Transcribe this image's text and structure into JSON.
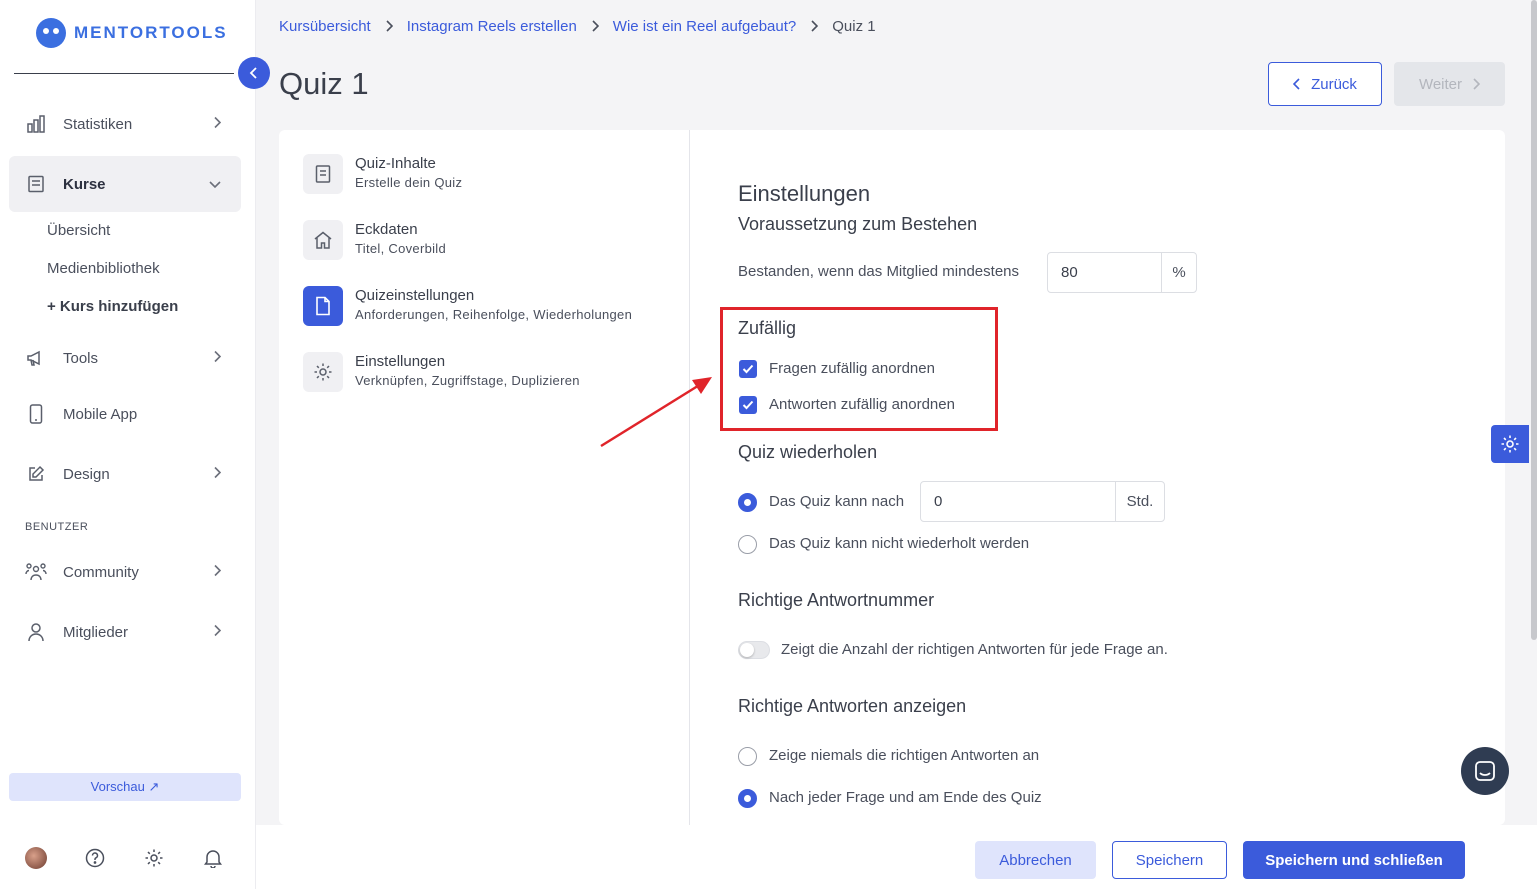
{
  "brand": {
    "name": "MENTORTOOLS"
  },
  "sidebar": {
    "items": [
      {
        "label": "Statistiken"
      },
      {
        "label": "Kurse"
      },
      {
        "label": "Tools"
      },
      {
        "label": "Mobile App"
      },
      {
        "label": "Design"
      },
      {
        "label": "Community"
      },
      {
        "label": "Mitglieder"
      }
    ],
    "sub_items": [
      {
        "label": "Übersicht"
      },
      {
        "label": "Medienbibliothek"
      },
      {
        "label": "+ Kurs hinzufügen"
      }
    ],
    "section_label": "BENUTZER",
    "preview_label": "Vorschau ↗"
  },
  "breadcrumb": [
    {
      "label": "Kursübersicht"
    },
    {
      "label": "Instagram Reels erstellen"
    },
    {
      "label": "Wie ist ein Reel aufgebaut?"
    },
    {
      "label": "Quiz 1"
    }
  ],
  "page": {
    "title": "Quiz 1",
    "back_label": "Zurück",
    "next_label": "Weiter"
  },
  "steps": [
    {
      "title": "Quiz-Inhalte",
      "subtitle": "Erstelle dein Quiz"
    },
    {
      "title": "Eckdaten",
      "subtitle": "Titel, Coverbild"
    },
    {
      "title": "Quizeinstellungen",
      "subtitle": "Anforderungen, Reihenfolge, Wiederholungen"
    },
    {
      "title": "Einstellungen",
      "subtitle": "Verknüpfen, Zugriffstage, Duplizieren"
    }
  ],
  "settings": {
    "heading": "Einstellungen",
    "pass": {
      "heading": "Voraussetzung zum Bestehen",
      "label": "Bestanden, wenn das Mitglied mindestens",
      "value": "80",
      "suffix": "%"
    },
    "random": {
      "heading": "Zufällig",
      "questions_label": "Fragen zufällig anordnen",
      "questions_checked": true,
      "answers_label": "Antworten zufällig anordnen",
      "answers_checked": true
    },
    "repeat": {
      "heading": "Quiz wiederholen",
      "option_after_label": "Das Quiz kann nach",
      "option_after_value": "0",
      "option_after_suffix": "Std.",
      "option_never_label": "Das Quiz kann nicht wiederholt werden",
      "selected": "after"
    },
    "correct_number": {
      "heading": "Richtige Antwortnummer",
      "toggle_label": "Zeigt die Anzahl der richtigen Antworten für jede Frage an.",
      "enabled": false
    },
    "show_correct": {
      "heading": "Richtige Antworten anzeigen",
      "option_never_label": "Zeige niemals die richtigen Antworten an",
      "option_each_label": "Nach jeder Frage und am Ende des Quiz",
      "selected": "each"
    }
  },
  "footer": {
    "cancel_label": "Abbrechen",
    "save_label": "Speichern",
    "save_close_label": "Speichern und schließen"
  },
  "colors": {
    "accent": "#3b5bdb",
    "annotation": "#e0242a"
  }
}
